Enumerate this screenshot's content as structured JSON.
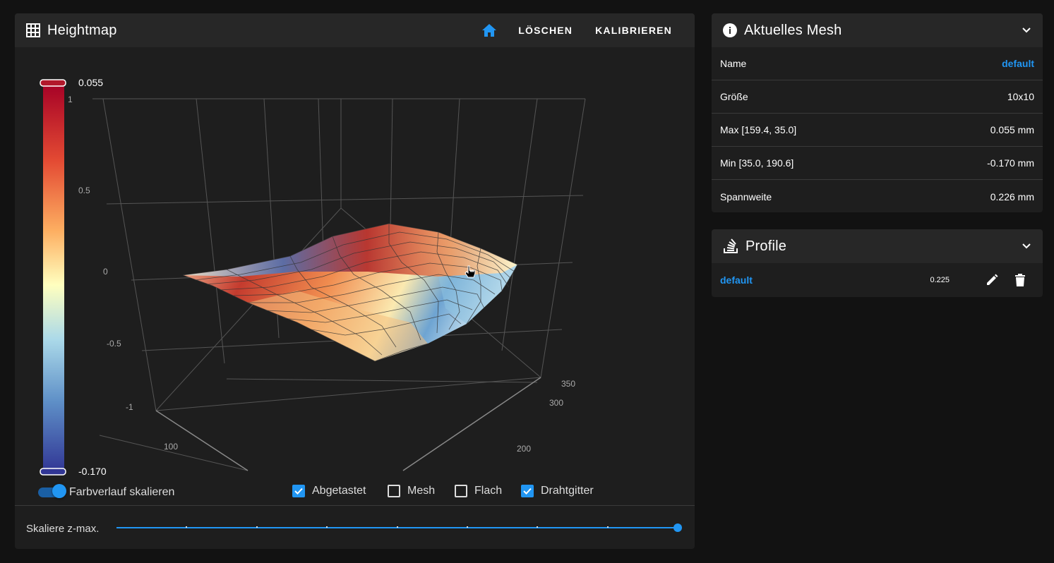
{
  "heightmap": {
    "title": "Heightmap",
    "icon": "grid-icon",
    "actions": {
      "home_icon": "home-icon",
      "clear_label": "LÖSCHEN",
      "calibrate_label": "KALIBRIEREN"
    },
    "colorbar": {
      "max_label": "0.055",
      "min_label": "-0.170"
    },
    "axis_ticks": {
      "z": [
        "1",
        "0.5",
        "0",
        "-0.5",
        "-1"
      ],
      "x": [
        "100"
      ],
      "y": [
        "200",
        "300",
        "350"
      ]
    },
    "colors": {
      "accent": "#2196f3",
      "high": "#a50026",
      "low": "#313695"
    },
    "controls": {
      "scale_gradient": {
        "label": "Farbverlauf skalieren",
        "on": true
      },
      "checkboxes": [
        {
          "label": "Abgetastet",
          "checked": true
        },
        {
          "label": "Mesh",
          "checked": false
        },
        {
          "label": "Flach",
          "checked": false
        },
        {
          "label": "Drahtgitter",
          "checked": true
        }
      ]
    },
    "zmax_slider": {
      "label": "Skaliere z-max.",
      "value_fraction": 1.0,
      "ticks": 9
    }
  },
  "current_mesh": {
    "title": "Aktuelles Mesh",
    "icon": "info-icon",
    "rows": [
      {
        "key": "Name",
        "value": "default",
        "link": true
      },
      {
        "key": "Größe",
        "value": "10x10"
      },
      {
        "key": "Max [159.4, 35.0]",
        "value": "0.055 mm"
      },
      {
        "key": "Min [35.0, 190.6]",
        "value": "-0.170 mm"
      },
      {
        "key": "Spannweite",
        "value": "0.226 mm"
      }
    ]
  },
  "profiles": {
    "title": "Profile",
    "icon": "stack-icon",
    "items": [
      {
        "name": "default",
        "value": "0.225"
      }
    ]
  }
}
